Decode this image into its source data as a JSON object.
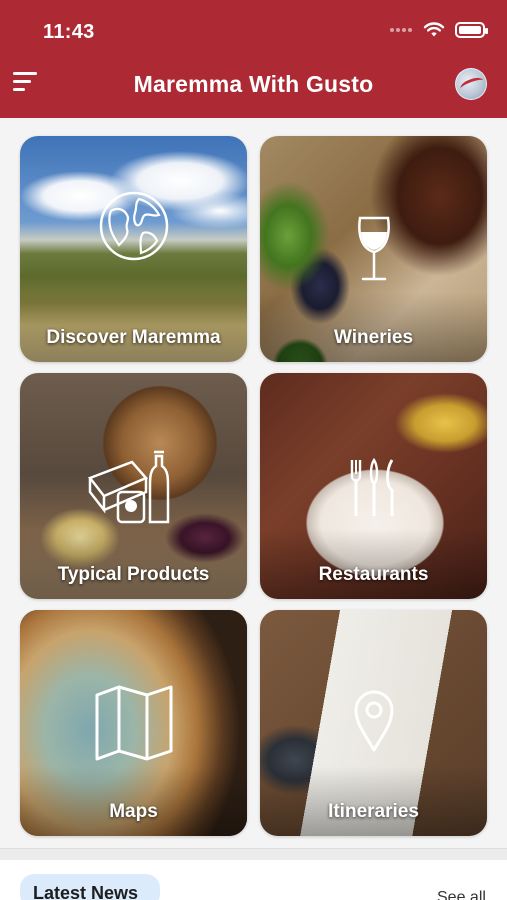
{
  "status_bar": {
    "time": "11:43"
  },
  "header": {
    "title": "Maremma With Gusto",
    "menu_icon": "hamburger-menu-icon",
    "logo_icon": "globe-logo-icon",
    "background_color": "#ad2a35"
  },
  "tiles": [
    {
      "label": "Discover Maremma",
      "icon": "globe-icon"
    },
    {
      "label": "Wineries",
      "icon": "wine-glass-icon"
    },
    {
      "label": "Typical Products",
      "icon": "food-products-icon"
    },
    {
      "label": "Restaurants",
      "icon": "cutlery-icon"
    },
    {
      "label": "Maps",
      "icon": "folded-map-icon"
    },
    {
      "label": "Itineraries",
      "icon": "location-pin-icon"
    }
  ],
  "news": {
    "title": "Latest News",
    "see_all": "See all"
  }
}
